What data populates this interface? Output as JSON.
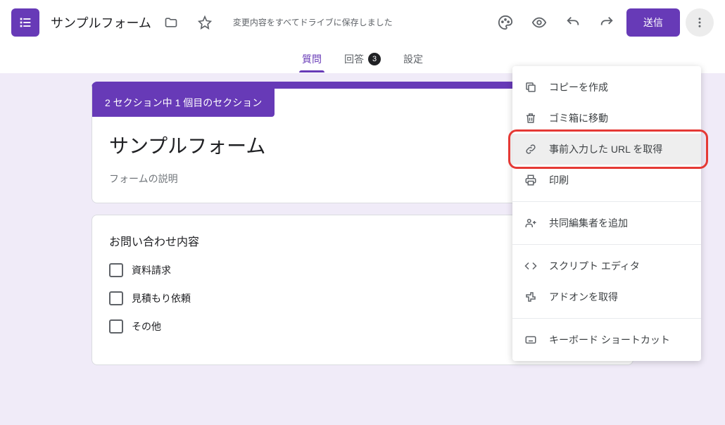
{
  "header": {
    "title": "サンプルフォーム",
    "saveStatus": "変更内容をすべてドライブに保存しました",
    "sendButton": "送信"
  },
  "tabs": {
    "questions": "質問",
    "responses": "回答",
    "responsesCount": "3",
    "settings": "設定"
  },
  "form": {
    "sectionBanner": "2 セクション中 1 個目のセクション",
    "title": "サンプルフォーム",
    "description": "フォームの説明",
    "question1": {
      "title": "お問い合わせ内容",
      "options": [
        "資料請求",
        "見積もり依頼",
        "その他"
      ]
    }
  },
  "menu": {
    "items": [
      {
        "icon": "copy",
        "label": "コピーを作成"
      },
      {
        "icon": "trash",
        "label": "ゴミ箱に移動"
      },
      {
        "icon": "link",
        "label": "事前入力した URL を取得"
      },
      {
        "icon": "print",
        "label": "印刷"
      },
      {
        "icon": "group",
        "label": "共同編集者を追加"
      },
      {
        "icon": "code",
        "label": "スクリプト エディタ"
      },
      {
        "icon": "addon",
        "label": "アドオンを取得"
      },
      {
        "icon": "keyboard",
        "label": "キーボード ショートカット"
      }
    ]
  }
}
